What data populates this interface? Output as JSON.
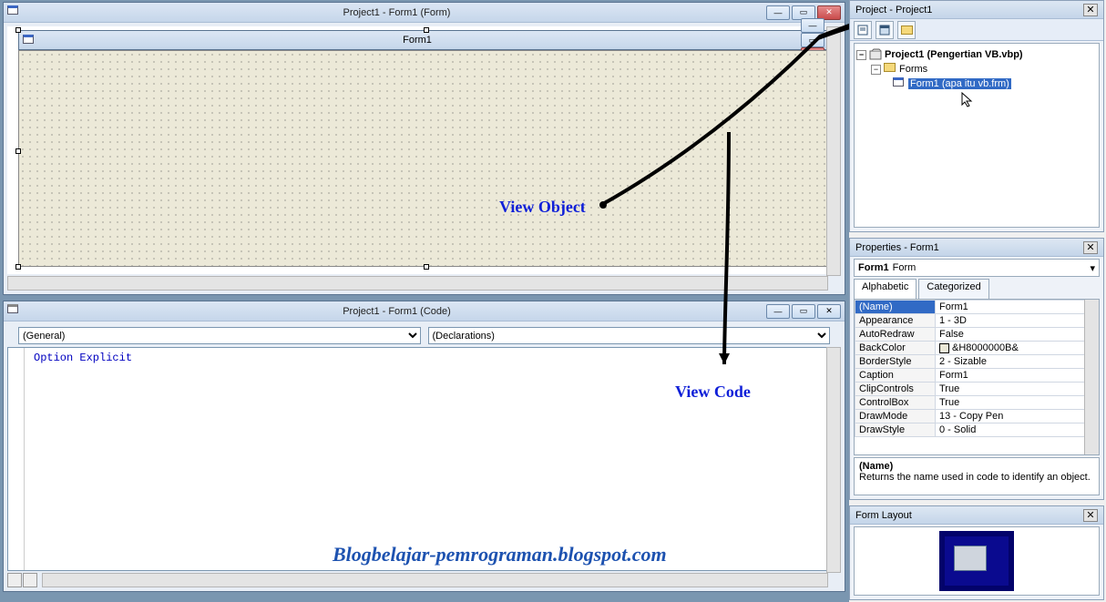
{
  "designer_window": {
    "title": "Project1 - Form1 (Form)"
  },
  "inner_form": {
    "title": "Form1"
  },
  "code_window": {
    "title": "Project1 - Form1 (Code)",
    "left_combo": "(General)",
    "right_combo": "(Declarations)",
    "code_line": "Option Explicit"
  },
  "annotations": {
    "view_object": "View Object",
    "view_code": "View Code"
  },
  "project_panel": {
    "title": "Project - Project1",
    "root": "Project1 (Pengertian VB.vbp)",
    "folder": "Forms",
    "item": "Form1 (apa itu vb.frm)"
  },
  "props_panel": {
    "title": "Properties - Form1",
    "object_name": "Form1",
    "object_type": "Form",
    "tab_alpha": "Alphabetic",
    "tab_cat": "Categorized",
    "rows": [
      {
        "k": "(Name)",
        "v": "Form1",
        "sel": true
      },
      {
        "k": "Appearance",
        "v": "1 - 3D"
      },
      {
        "k": "AutoRedraw",
        "v": "False"
      },
      {
        "k": "BackColor",
        "v": "&H8000000B&",
        "swatch": true
      },
      {
        "k": "BorderStyle",
        "v": "2 - Sizable"
      },
      {
        "k": "Caption",
        "v": "Form1"
      },
      {
        "k": "ClipControls",
        "v": "True"
      },
      {
        "k": "ControlBox",
        "v": "True"
      },
      {
        "k": "DrawMode",
        "v": "13 - Copy Pen"
      },
      {
        "k": "DrawStyle",
        "v": "0 - Solid"
      }
    ],
    "desc_name": "(Name)",
    "desc_text": "Returns the name used in code to identify an object."
  },
  "layout_panel": {
    "title": "Form Layout"
  },
  "watermark": "Blogbelajar-pemrograman.blogspot.com"
}
